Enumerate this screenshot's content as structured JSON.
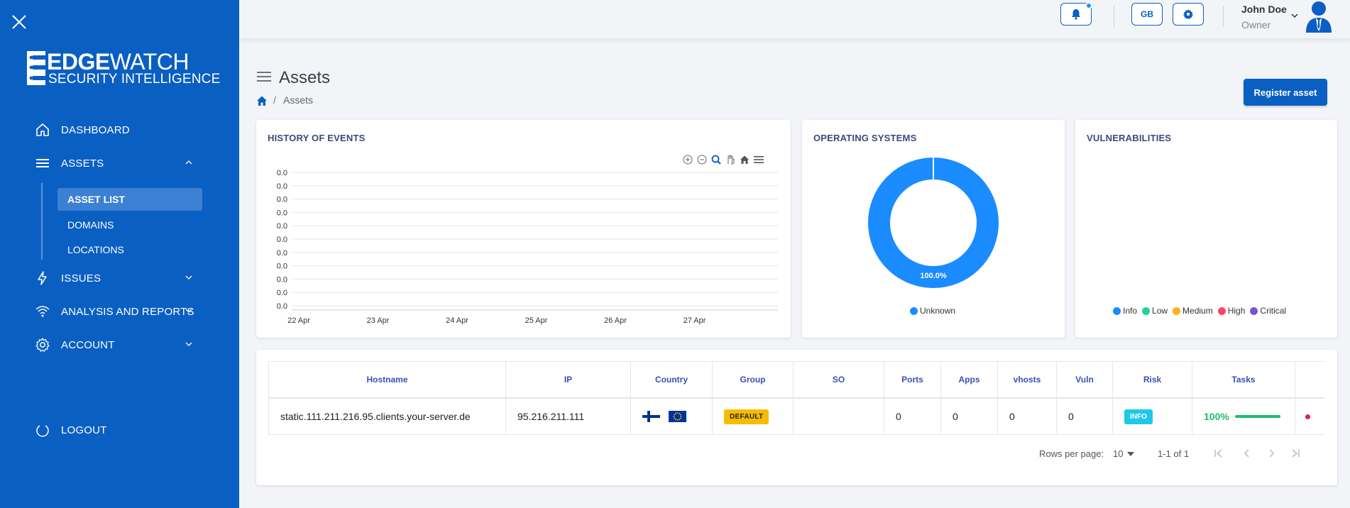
{
  "sidebar": {
    "logo": {
      "line1_bold": "EDGE",
      "line1_light": "WATCH",
      "line2": "SECURITY INTELLIGENCE"
    },
    "items": [
      {
        "label": "DASHBOARD"
      },
      {
        "label": "ASSETS"
      },
      {
        "label": "ISSUES"
      },
      {
        "label": "ANALYSIS AND REPORTS"
      },
      {
        "label": "ACCOUNT"
      }
    ],
    "sub_items": [
      {
        "label": "ASSET LIST"
      },
      {
        "label": "DOMAINS"
      },
      {
        "label": "LOCATIONS"
      }
    ],
    "logout": "LOGOUT"
  },
  "topbar": {
    "lang": "GB",
    "user": {
      "name": "John Doe",
      "role": "Owner"
    }
  },
  "page": {
    "title": "Assets",
    "breadcrumb_current": "Assets",
    "register_button": "Register asset"
  },
  "history": {
    "title": "HISTORY OF EVENTS",
    "y_ticks": [
      "0.0",
      "0.0",
      "0.0",
      "0.0",
      "0.0",
      "0.0",
      "0.0",
      "0.0",
      "0.0",
      "0.0",
      "0.0"
    ],
    "x_ticks": [
      "22 Apr",
      "23 Apr",
      "24 Apr",
      "25 Apr",
      "26 Apr",
      "27 Apr"
    ]
  },
  "os": {
    "title": "OPERATING SYSTEMS",
    "slice_label": "100.0%",
    "legend": [
      {
        "label": "Unknown",
        "color": "#1a8cff"
      }
    ]
  },
  "vuln": {
    "title": "VULNERABILITIES",
    "legend": [
      {
        "label": "Info",
        "color": "#1a8cff"
      },
      {
        "label": "Low",
        "color": "#22d39a"
      },
      {
        "label": "Medium",
        "color": "#ffb020"
      },
      {
        "label": "High",
        "color": "#ff4560"
      },
      {
        "label": "Critical",
        "color": "#7a52cc"
      }
    ]
  },
  "chart_data": [
    {
      "type": "line",
      "title": "HISTORY OF EVENTS",
      "x": [
        "22 Apr",
        "23 Apr",
        "24 Apr",
        "25 Apr",
        "26 Apr",
        "27 Apr"
      ],
      "series": [],
      "ylim": [
        0,
        0
      ],
      "grid": true
    },
    {
      "type": "pie",
      "title": "OPERATING SYSTEMS",
      "categories": [
        "Unknown"
      ],
      "values": [
        100.0
      ],
      "legend": "bottom"
    },
    {
      "type": "pie",
      "title": "VULNERABILITIES",
      "categories": [
        "Info",
        "Low",
        "Medium",
        "High",
        "Critical"
      ],
      "values": [],
      "legend": "bottom"
    }
  ],
  "table": {
    "headers": [
      "Hostname",
      "IP",
      "Country",
      "Group",
      "SO",
      "Ports",
      "Apps",
      "vhosts",
      "Vuln",
      "Risk",
      "Tasks"
    ],
    "rows": [
      {
        "hostname": "static.111.211.216.95.clients.your-server.de",
        "ip": "95.216.211.111",
        "group": "DEFAULT",
        "so": "",
        "ports": "0",
        "apps": "0",
        "vhosts": "0",
        "vuln": "0",
        "risk": "INFO",
        "tasks": "100%",
        "tasks_progress": 1.0
      }
    ],
    "pager": {
      "rows_label": "Rows per page:",
      "rows_value": "10",
      "range": "1-1 of 1"
    }
  }
}
